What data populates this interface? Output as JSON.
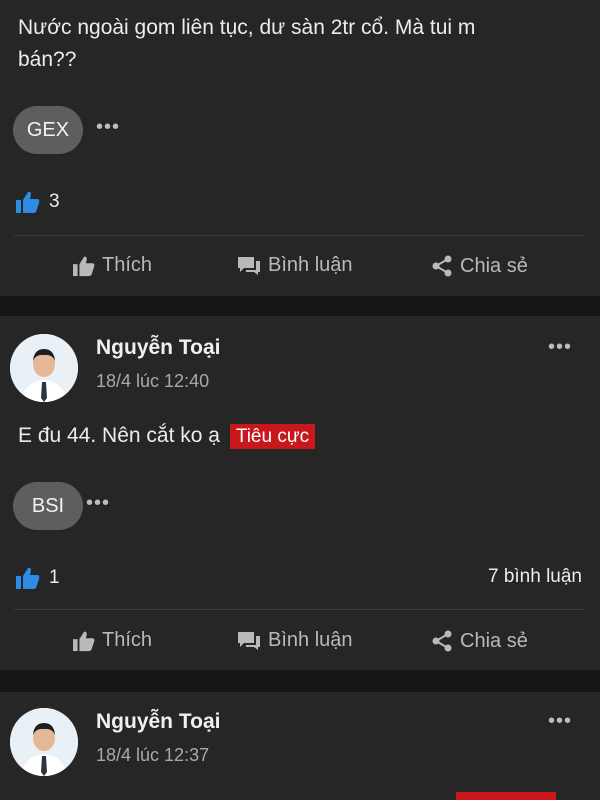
{
  "post1": {
    "text_line1": "Nước ngoài gom liên tục, dư sàn 2tr cổ. Mà tui m",
    "text_line2": "bán??",
    "stock": "GEX",
    "likes": "3"
  },
  "post2": {
    "author": "Nguyễn Toại",
    "time": "18/4 lúc 12:40",
    "text": "E đu 44. Nên cắt ko ạ",
    "tag": "Tiêu cực",
    "stock": "BSI",
    "likes": "1",
    "comments": "7 bình luận"
  },
  "post3": {
    "author": "Nguyễn Toại",
    "time": "18/4 lúc 12:37"
  },
  "actions": {
    "like": "Thích",
    "comment": "Bình luận",
    "share": "Chia sẻ"
  },
  "colors": {
    "background": "#262626",
    "tag": "#c8181e",
    "like_blue": "#2e8ce6"
  }
}
